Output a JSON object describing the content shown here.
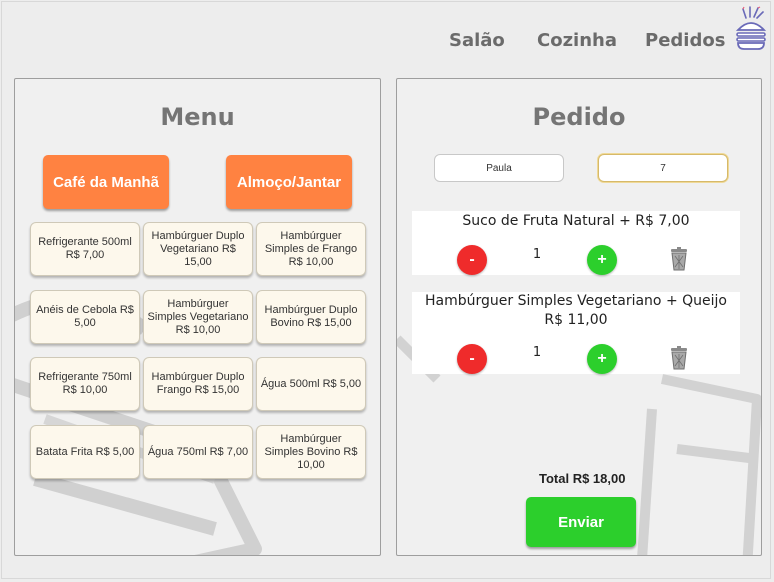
{
  "nav": {
    "salao": "Salão",
    "cozinha": "Cozinha",
    "pedidos": "Pedidos"
  },
  "menu": {
    "title": "Menu",
    "categories": [
      "Café da Manhã",
      "Almoço/Jantar"
    ],
    "products": [
      "Refrigerante 500ml R$ 7,00",
      "Hambúrguer Duplo Vegetariano R$ 15,00",
      "Hambúrguer Simples de Frango R$ 10,00",
      "Anéis de Cebola R$ 5,00",
      "Hambúrguer Simples Vegetariano R$ 10,00",
      "Hambúrguer Duplo Bovino R$ 15,00",
      "Refrigerante 750ml R$ 10,00",
      "Hambúrguer Duplo Frango R$ 15,00",
      "Água 500ml R$ 5,00",
      "Batata Frita R$ 5,00",
      "Água 750ml R$ 7,00",
      "Hambúrguer Simples Bovino R$ 10,00"
    ]
  },
  "pedido": {
    "title": "Pedido",
    "client_name": "Paula",
    "table_number": "7",
    "items": [
      {
        "name": "Suco de Fruta Natural + R$ 7,00",
        "qty": "1",
        "minus": "-",
        "plus": "+"
      },
      {
        "name": "Hambúrguer Simples Vegetariano + Queijo R$ 11,00",
        "qty": "1",
        "minus": "-",
        "plus": "+"
      }
    ],
    "total": "Total R$ 18,00",
    "send_label": "Enviar"
  },
  "icons": {
    "logo": "burger-logo-icon",
    "trash": "trash-icon"
  },
  "colors": {
    "accent": "#ff8241",
    "send": "#2ccf2c",
    "remove": "#ef2b2b",
    "logo": "#6a6ab8"
  }
}
